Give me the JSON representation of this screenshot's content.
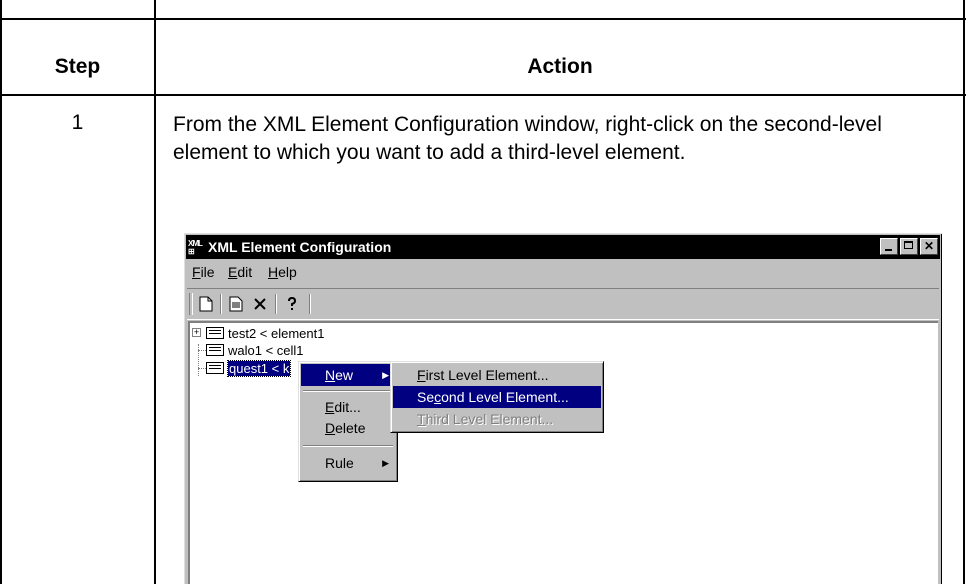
{
  "table": {
    "header_step": "Step",
    "header_action": "Action",
    "rows": [
      {
        "step": "1",
        "action": "From the XML Element Configuration window, right-click on the second-level element to which you want to add a third-level element."
      }
    ]
  },
  "window": {
    "title": "XML Element Configuration",
    "app_icon_text": "XML",
    "menubar": [
      {
        "label": "File",
        "mnemonic": "F",
        "rest": "ile"
      },
      {
        "label": "Edit",
        "mnemonic": "E",
        "rest": "dit"
      },
      {
        "label": "Help",
        "mnemonic": "H",
        "rest": "elp"
      }
    ],
    "toolbar": [
      "new-icon",
      "properties-icon",
      "delete-icon",
      "help-icon"
    ],
    "tree": [
      {
        "label": "test2 < element1",
        "expandable": true
      },
      {
        "label": "walo1 < cell1",
        "expandable": false
      },
      {
        "label": "quest1 < k",
        "expandable": false,
        "selected": true
      }
    ],
    "context_menu": {
      "items": [
        {
          "label": "New",
          "mnemonic": "N",
          "rest": "ew",
          "submenu": true,
          "highlighted": true
        },
        {
          "label": "Edit...",
          "mnemonic": "E",
          "rest": "dit..."
        },
        {
          "label": "Delete",
          "mnemonic": "D",
          "rest": "elete"
        },
        {
          "label": "Rule",
          "submenu": true
        }
      ]
    },
    "submenu": {
      "items": [
        {
          "label": "First Level Element...",
          "pre": "",
          "mnemonic": "F",
          "rest": "irst Level Element...",
          "state": "normal"
        },
        {
          "label": "Second Level Element...",
          "pre": "Se",
          "mnemonic": "c",
          "rest": "ond Level Element...",
          "state": "highlighted"
        },
        {
          "label": "Third Level Element...",
          "pre": "",
          "mnemonic": "T",
          "rest": "hird Level Element...",
          "state": "disabled"
        }
      ]
    },
    "colors": {
      "titlebar": "#000000",
      "face": "#c0c0c0",
      "highlight": "#000080"
    }
  }
}
